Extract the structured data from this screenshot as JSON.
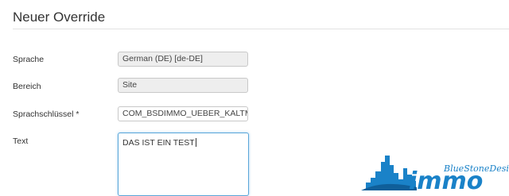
{
  "page": {
    "title": "Neuer Override"
  },
  "form": {
    "sprache": {
      "label": "Sprache",
      "value": "German (DE) [de-DE]"
    },
    "bereich": {
      "label": "Bereich",
      "value": "Site"
    },
    "schluessel": {
      "label": "Sprachschlüssel *",
      "value": "COM_BSDIMMO_UEBER_KALTMIETE"
    },
    "text": {
      "label": "Text",
      "value": "DAS IST EIN TEST"
    }
  },
  "logo": {
    "tagline": "BlueStoneDesign",
    "wordmark": "immo"
  },
  "colors": {
    "accent": "#1a82c8",
    "focus_border": "#5aa6d8",
    "readonly_bg": "#eeeeee"
  }
}
